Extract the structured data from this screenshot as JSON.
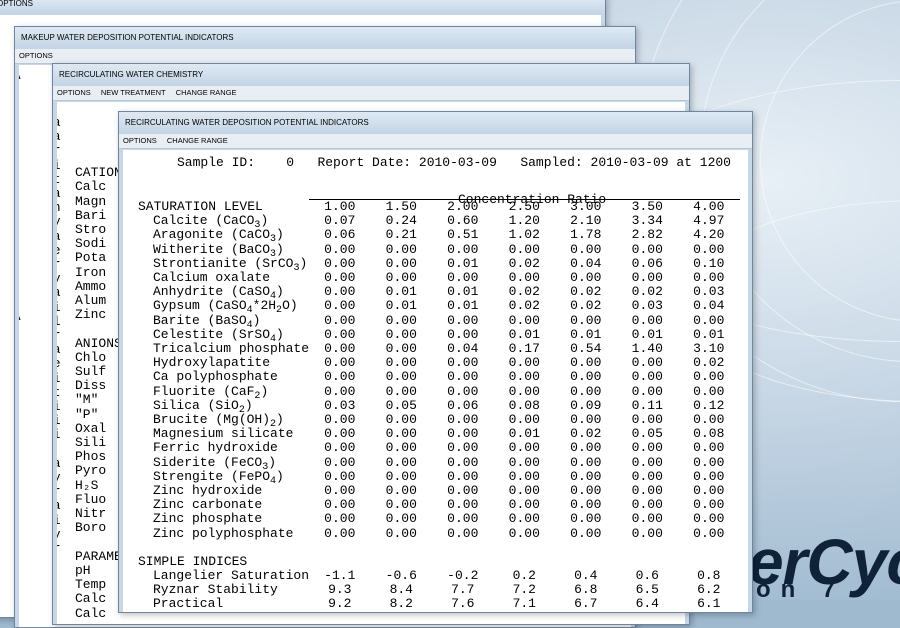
{
  "desktop": {
    "brand_text": "erCyc",
    "brand_version": "on 7"
  },
  "windows": [
    {
      "title": "OPTIONS",
      "menu": []
    },
    {
      "title": "MAKEUP WATER DEPOSITION POTENTIAL INDICATORS",
      "menu": [
        "OPTIONS"
      ],
      "lines": [
        "CA",
        "PA"
      ]
    },
    {
      "title": "RECIRCULATING WATER CHEMISTRY",
      "menu": [
        "OPTIONS",
        "NEW TREATMENT",
        "CHANGE RANGE"
      ],
      "lines": [
        "Sa",
        "Ca",
        "Ar",
        "Wi",
        "St",
        "Ca",
        "An",
        "Gy",
        "Ba",
        "Ce",
        "Tr",
        "Hy",
        "Ca",
        "Si",
        "Fl",
        "Br",
        "Ma",
        "Fe",
        "Si",
        "St",
        "Zi",
        "Zi",
        "Zi",
        "",
        "La",
        "Ry",
        "Pr",
        "La",
        "Zi",
        "Py",
        "Or"
      ],
      "detail": [
        "",
        "CATION",
        "Calc",
        "Magn",
        "Bari",
        "Stro",
        "Sodi",
        "Pota",
        "Iron",
        "Ammo",
        "Alum",
        "Zinc",
        "",
        "ANIONS",
        "Chlo",
        "Sulf",
        "Diss",
        "\"M\"",
        "\"P\"",
        "Oxal",
        "Sili",
        "Phos",
        "Pyro",
        "H₂S",
        "Fluo",
        "Nitr",
        "Boro",
        "",
        "PARAME",
        "pH",
        "Temp",
        "Calc",
        "Calc"
      ]
    }
  ],
  "report_window": {
    "title": "RECIRCULATING WATER DEPOSITION POTENTIAL INDICATORS",
    "menu": [
      "OPTIONS",
      "CHANGE RANGE"
    ],
    "sample_id_label": "Sample ID:",
    "sample_id": "0",
    "report_date_label": "Report Date:",
    "report_date": "2010-03-09",
    "sampled_label": "Sampled:",
    "sampled": "2010-03-09 at 1200",
    "concentration_label": "Concentration Ratio",
    "saturation_heading": "SATURATION LEVEL",
    "ratios": [
      "1.00",
      "1.50",
      "2.00",
      "2.50",
      "3.00",
      "3.50",
      "4.00"
    ],
    "saturation_rows": [
      {
        "name": "Calcite (CaCO<sub>3</sub>)",
        "values": [
          "0.07",
          "0.24",
          "0.60",
          "1.20",
          "2.10",
          "3.34",
          "4.97"
        ]
      },
      {
        "name": "Aragonite (CaCO<sub>3</sub>)",
        "values": [
          "0.06",
          "0.21",
          "0.51",
          "1.02",
          "1.78",
          "2.82",
          "4.20"
        ]
      },
      {
        "name": "Witherite (BaCO<sub>3</sub>)",
        "values": [
          "0.00",
          "0.00",
          "0.00",
          "0.00",
          "0.00",
          "0.00",
          "0.00"
        ]
      },
      {
        "name": "Strontianite (SrCO<sub>3</sub>)",
        "values": [
          "0.00",
          "0.00",
          "0.01",
          "0.02",
          "0.04",
          "0.06",
          "0.10"
        ]
      },
      {
        "name": "Calcium oxalate",
        "values": [
          "0.00",
          "0.00",
          "0.00",
          "0.00",
          "0.00",
          "0.00",
          "0.00"
        ]
      },
      {
        "name": "Anhydrite (CaSO<sub>4</sub>)",
        "values": [
          "0.00",
          "0.01",
          "0.01",
          "0.02",
          "0.02",
          "0.02",
          "0.03"
        ]
      },
      {
        "name": "Gypsum (CaSO<sub>4</sub>*2H<sub>2</sub>O)",
        "values": [
          "0.00",
          "0.01",
          "0.01",
          "0.02",
          "0.02",
          "0.03",
          "0.04"
        ]
      },
      {
        "name": "Barite (BaSO<sub>4</sub>)",
        "values": [
          "0.00",
          "0.00",
          "0.00",
          "0.00",
          "0.00",
          "0.00",
          "0.00"
        ]
      },
      {
        "name": "Celestite (SrSO<sub>4</sub>)",
        "values": [
          "0.00",
          "0.00",
          "0.00",
          "0.01",
          "0.01",
          "0.01",
          "0.01"
        ]
      },
      {
        "name": "Tricalcium phosphate",
        "values": [
          "0.00",
          "0.00",
          "0.04",
          "0.17",
          "0.54",
          "1.40",
          "3.10"
        ]
      },
      {
        "name": "Hydroxylapatite",
        "values": [
          "0.00",
          "0.00",
          "0.00",
          "0.00",
          "0.00",
          "0.00",
          "0.02"
        ]
      },
      {
        "name": "Ca polyphosphate",
        "values": [
          "0.00",
          "0.00",
          "0.00",
          "0.00",
          "0.00",
          "0.00",
          "0.00"
        ]
      },
      {
        "name": "Fluorite (CaF<sub>2</sub>)",
        "values": [
          "0.00",
          "0.00",
          "0.00",
          "0.00",
          "0.00",
          "0.00",
          "0.00"
        ]
      },
      {
        "name": "Silica (SiO<sub>2</sub>)",
        "values": [
          "0.03",
          "0.05",
          "0.06",
          "0.08",
          "0.09",
          "0.11",
          "0.12"
        ]
      },
      {
        "name": "Brucite (Mg(OH)<sub>2</sub>)",
        "values": [
          "0.00",
          "0.00",
          "0.00",
          "0.00",
          "0.00",
          "0.00",
          "0.00"
        ]
      },
      {
        "name": "Magnesium silicate",
        "values": [
          "0.00",
          "0.00",
          "0.00",
          "0.01",
          "0.02",
          "0.05",
          "0.08"
        ]
      },
      {
        "name": "Ferric hydroxide",
        "values": [
          "0.00",
          "0.00",
          "0.00",
          "0.00",
          "0.00",
          "0.00",
          "0.00"
        ]
      },
      {
        "name": "Siderite (FeCO<sub>3</sub>)",
        "values": [
          "0.00",
          "0.00",
          "0.00",
          "0.00",
          "0.00",
          "0.00",
          "0.00"
        ]
      },
      {
        "name": "Strengite (FePO<sub>4</sub>)",
        "values": [
          "0.00",
          "0.00",
          "0.00",
          "0.00",
          "0.00",
          "0.00",
          "0.00"
        ]
      },
      {
        "name": "Zinc hydroxide",
        "values": [
          "0.00",
          "0.00",
          "0.00",
          "0.00",
          "0.00",
          "0.00",
          "0.00"
        ]
      },
      {
        "name": "Zinc carbonate",
        "values": [
          "0.00",
          "0.00",
          "0.00",
          "0.00",
          "0.00",
          "0.00",
          "0.00"
        ]
      },
      {
        "name": "Zinc phosphate",
        "values": [
          "0.00",
          "0.00",
          "0.00",
          "0.00",
          "0.00",
          "0.00",
          "0.00"
        ]
      },
      {
        "name": "Zinc polyphosphate",
        "values": [
          "0.00",
          "0.00",
          "0.00",
          "0.00",
          "0.00",
          "0.00",
          "0.00"
        ]
      }
    ],
    "indices_heading": "SIMPLE INDICES",
    "indices_rows": [
      {
        "name": "Langelier Saturation",
        "values": [
          "-1.1",
          "-0.6",
          "-0.2",
          "0.2",
          "0.4",
          "0.6",
          "0.8"
        ]
      },
      {
        "name": "Ryznar Stability",
        "values": [
          "9.3",
          "8.4",
          "7.7",
          "7.2",
          "6.8",
          "6.5",
          "6.2"
        ]
      },
      {
        "name": "Practical",
        "values": [
          "9.2",
          "8.2",
          "7.6",
          "7.1",
          "6.7",
          "6.4",
          "6.1"
        ]
      }
    ]
  }
}
